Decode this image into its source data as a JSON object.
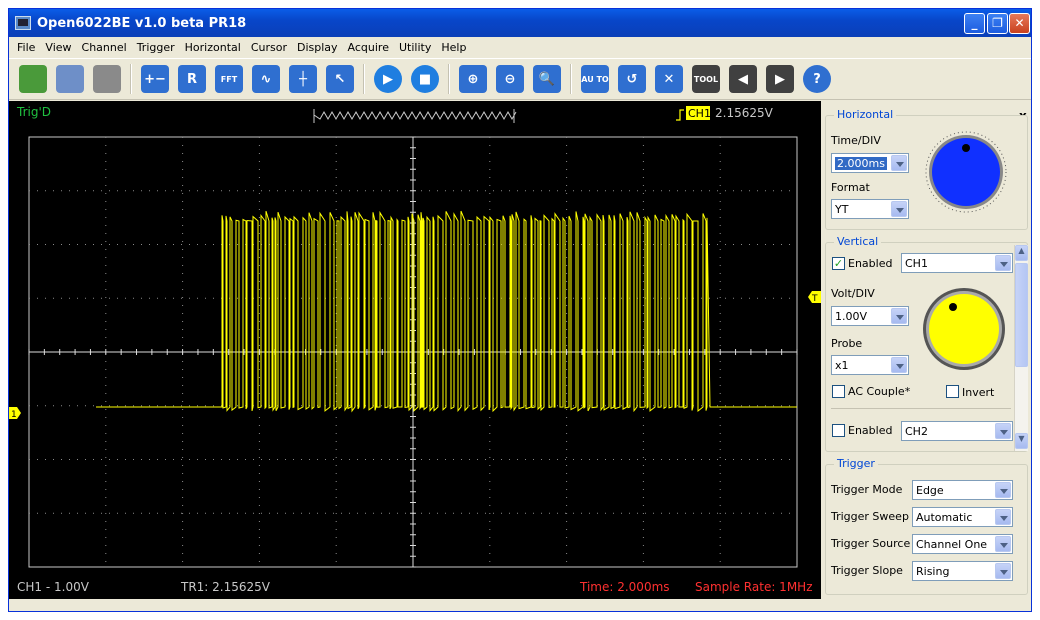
{
  "window": {
    "title": "Open6022BE v1.0 beta PR18"
  },
  "menu": [
    "File",
    "View",
    "Channel",
    "Trigger",
    "Horizontal",
    "Cursor",
    "Display",
    "Acquire",
    "Utility",
    "Help"
  ],
  "toolbar": {
    "buttons": [
      {
        "name": "open-icon",
        "color": "#4a9a3a",
        "glyph": ""
      },
      {
        "name": "save-icon",
        "color": "#6e8fc8",
        "glyph": ""
      },
      {
        "name": "print-icon",
        "color": "#8a8a8a",
        "glyph": ""
      },
      {
        "name": "math-icon",
        "color": "#2f6fd0",
        "glyph": "+−"
      },
      {
        "name": "reference-icon",
        "color": "#2f6fd0",
        "glyph": "R"
      },
      {
        "name": "fft-icon",
        "color": "#2f6fd0",
        "glyph": "FFT"
      },
      {
        "name": "waveform-icon",
        "color": "#2f6fd0",
        "glyph": "∿"
      },
      {
        "name": "cursor-icon",
        "color": "#2f6fd0",
        "glyph": "┼"
      },
      {
        "name": "select-icon",
        "color": "#2f6fd0",
        "glyph": "↖"
      },
      {
        "name": "run-icon",
        "color": "#1f7ee0",
        "glyph": "▶"
      },
      {
        "name": "stop-icon",
        "color": "#1f7ee0",
        "glyph": "■"
      },
      {
        "name": "zoom-in-icon",
        "color": "#2f6fd0",
        "glyph": "⊕"
      },
      {
        "name": "zoom-out-icon",
        "color": "#2f6fd0",
        "glyph": "⊖"
      },
      {
        "name": "zoom-icon",
        "color": "#2f6fd0",
        "glyph": "🔍"
      },
      {
        "name": "auto-icon",
        "color": "#2f6fd0",
        "glyph": "AU TO"
      },
      {
        "name": "reset-icon",
        "color": "#2f6fd0",
        "glyph": "↺"
      },
      {
        "name": "fullscreen-icon",
        "color": "#2f6fd0",
        "glyph": "✕"
      },
      {
        "name": "tool-icon",
        "color": "#404040",
        "glyph": "TOOL"
      },
      {
        "name": "prev-frame-icon",
        "color": "#404040",
        "glyph": "◀"
      },
      {
        "name": "next-frame-icon",
        "color": "#404040",
        "glyph": "▶"
      },
      {
        "name": "help-icon",
        "color": "#2f6fd0",
        "glyph": "?"
      }
    ]
  },
  "scope": {
    "trig_status": "Trig'D",
    "trigger_channel": "CH1",
    "trigger_level": "2.15625V",
    "ch1_scale": "CH1 - 1.00V",
    "trigger_readout": "TR1: 2.15625V",
    "time_readout": "Time: 2.000ms",
    "sample_rate": "Sample Rate: 1MHz",
    "ch1_marker": "1",
    "trigger_marker": "T",
    "trace_color": "#ffff00",
    "grid_color": "#8a8a8a",
    "text_color": "#c8c8c8",
    "readout_red": "#ff3030",
    "trig_green": "#20c040"
  },
  "panel": {
    "close_glyph": "x",
    "horizontal": {
      "title": "Horizontal",
      "time_div_label": "Time/DIV",
      "time_div_value": "2.000ms",
      "format_label": "Format",
      "format_value": "YT",
      "knob_color": "#1030ff"
    },
    "vertical": {
      "title": "Vertical",
      "enabled_label": "Enabled",
      "ch1_enabled": true,
      "ch1_value": "CH1",
      "volt_div_label": "Volt/DIV",
      "volt_div_value": "1.00V",
      "probe_label": "Probe",
      "probe_value": "x1",
      "ac_couple_label": "AC Couple*",
      "invert_label": "Invert",
      "ch2_enabled_label": "Enabled",
      "ch2_value": "CH2",
      "knob_color": "#ffff00"
    },
    "trigger": {
      "title": "Trigger",
      "mode_label": "Trigger Mode",
      "mode_value": "Edge",
      "sweep_label": "Trigger Sweep",
      "sweep_value": "Automatic",
      "source_label": "Trigger Source",
      "source_value": "Channel One",
      "slope_label": "Trigger Slope",
      "slope_value": "Rising"
    }
  }
}
